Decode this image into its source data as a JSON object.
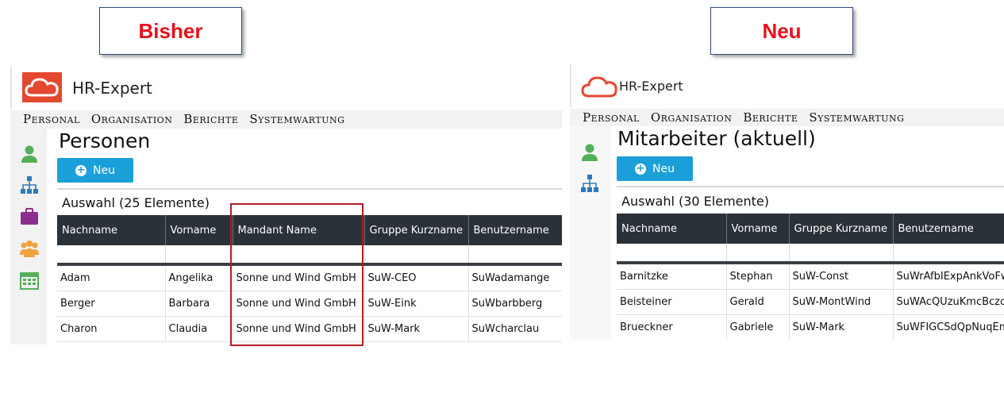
{
  "labels": {
    "before": "Bisher",
    "after": "Neu"
  },
  "app": {
    "name": "HR-Expert"
  },
  "menu": [
    "Personal",
    "Organisation",
    "Berichte",
    "Systemwartung"
  ],
  "colors": {
    "label_red": "#e8101a",
    "logo_red": "#e4482f",
    "button_blue": "#1b9fd8",
    "header_dark": "#2a3138",
    "icon_green": "#52b05a",
    "icon_blue": "#2b7bbf",
    "icon_purple": "#8b2f8c",
    "icon_orange": "#f0a23c"
  },
  "left": {
    "sidebar_icons": [
      "person-icon",
      "org-chart-icon",
      "briefcase-icon",
      "group-icon",
      "calendar-icon"
    ],
    "title": "Personen",
    "new_button": "Neu",
    "selection": "Auswahl (25 Elemente)",
    "columns": [
      "Nachname",
      "Vorname",
      "Mandant Name",
      "Gruppe Kurzname",
      "Benutzername"
    ],
    "rows": [
      [
        "Adam",
        "Angelika",
        "Sonne und Wind GmbH",
        "SuW-CEO",
        "SuWadamange"
      ],
      [
        "Berger",
        "Barbara",
        "Sonne und Wind GmbH",
        "SuW-Eink",
        "SuWbarbberg"
      ],
      [
        "Charon",
        "Claudia",
        "Sonne und Wind GmbH",
        "SuW-Mark",
        "SuWcharclau"
      ]
    ]
  },
  "right": {
    "sidebar_icons": [
      "person-icon",
      "org-chart-icon"
    ],
    "title": "Mitarbeiter (aktuell)",
    "new_button": "Neu",
    "selection": "Auswahl (30 Elemente)",
    "columns": [
      "Nachname",
      "Vorname",
      "Gruppe Kurzname",
      "Benutzername"
    ],
    "rows": [
      [
        "Barnitzke",
        "Stephan",
        "SuW-Const",
        "SuWrAfbIExpAnkVoFw"
      ],
      [
        "Beisteiner",
        "Gerald",
        "SuW-MontWind",
        "SuWAcQUzuKmcBczoE"
      ],
      [
        "Brueckner",
        "Gabriele",
        "SuW-Mark",
        "SuWFIGCSdQpNuqEm"
      ]
    ]
  }
}
